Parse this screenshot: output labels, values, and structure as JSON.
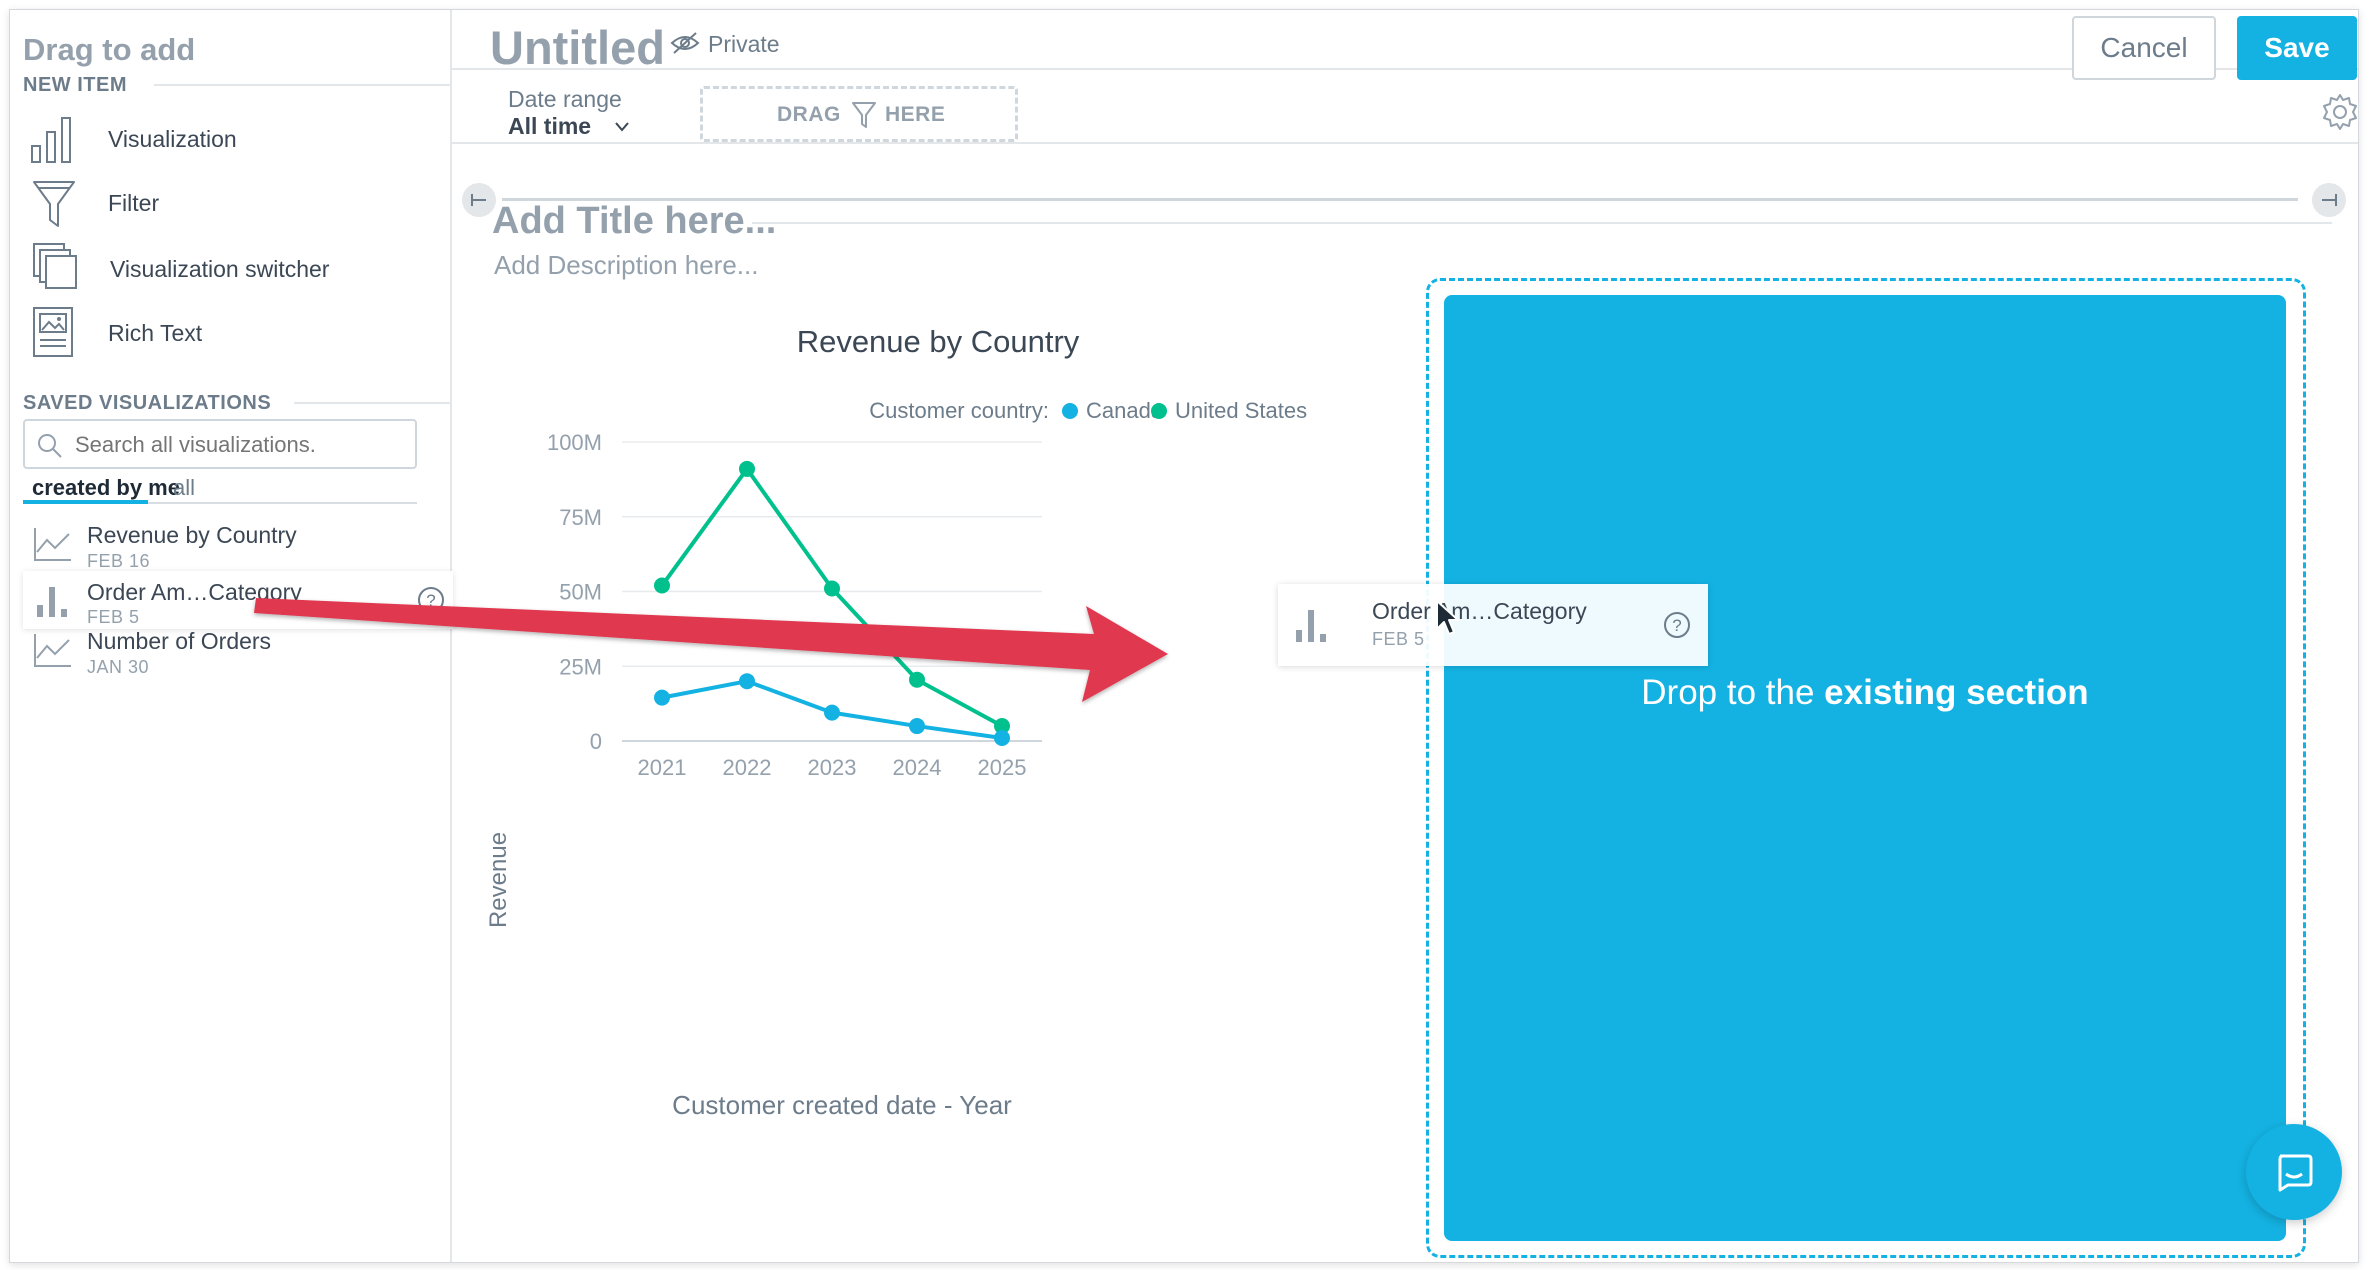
{
  "sidebar": {
    "title": "Drag to add",
    "new_item_label": "NEW ITEM",
    "new_items": [
      {
        "label": "Visualization",
        "icon": "bar-chart-icon"
      },
      {
        "label": "Filter",
        "icon": "funnel-icon"
      },
      {
        "label": "Visualization switcher",
        "icon": "stacked-pages-icon"
      },
      {
        "label": "Rich Text",
        "icon": "rich-text-icon"
      }
    ],
    "saved_label": "SAVED VISUALIZATIONS",
    "search": {
      "placeholder": "Search all visualizations.",
      "value": ""
    },
    "tabs": [
      {
        "label": "created by me",
        "active": true
      },
      {
        "label": "all",
        "active": false
      }
    ],
    "saved": [
      {
        "name": "Revenue by Country",
        "date": "FEB 16",
        "icon": "line-chart-icon"
      },
      {
        "name": "Order Am…Category",
        "date": "FEB 5",
        "icon": "bar-chart-icon"
      },
      {
        "name": "Number of Orders",
        "date": "JAN 30",
        "icon": "line-chart-icon"
      }
    ]
  },
  "header": {
    "title": "Untitled",
    "privacy": "Private",
    "cancel_label": "Cancel",
    "save_label": "Save"
  },
  "filter_bar": {
    "date_range_label": "Date range",
    "date_range_value": "All time",
    "drag_left": "DRAG",
    "drag_right": "HERE"
  },
  "section": {
    "title_placeholder": "Add Title here...",
    "description_placeholder": "Add Description here..."
  },
  "drop_zone": {
    "text_prefix": "Drop to the ",
    "text_bold": "existing section"
  },
  "drag_ghost": {
    "name": "Order Am…Category",
    "date": "FEB 5"
  },
  "colors": {
    "accent": "#14b2e2",
    "canada": "#14b2e2",
    "united_states": "#00c18d",
    "arrow": "#e0374f"
  },
  "chart_data": {
    "type": "line",
    "title": "Revenue by Country",
    "legend_title": "Customer country:",
    "legend_position": "top-right",
    "xlabel": "Customer created date - Year",
    "ylabel": "Revenue",
    "categories": [
      "2021",
      "2022",
      "2023",
      "2024",
      "2025"
    ],
    "y_ticks": [
      "0",
      "25M",
      "50M",
      "75M",
      "100M"
    ],
    "ylim": [
      0,
      100000000
    ],
    "grid": true,
    "series": [
      {
        "name": "Canada",
        "color": "#14b2e2",
        "values": [
          14500000,
          20000000,
          9500000,
          5000000,
          1000000
        ]
      },
      {
        "name": "United States",
        "color": "#00c18d",
        "values": [
          52000000,
          91000000,
          51000000,
          20500000,
          5000000
        ]
      }
    ]
  }
}
